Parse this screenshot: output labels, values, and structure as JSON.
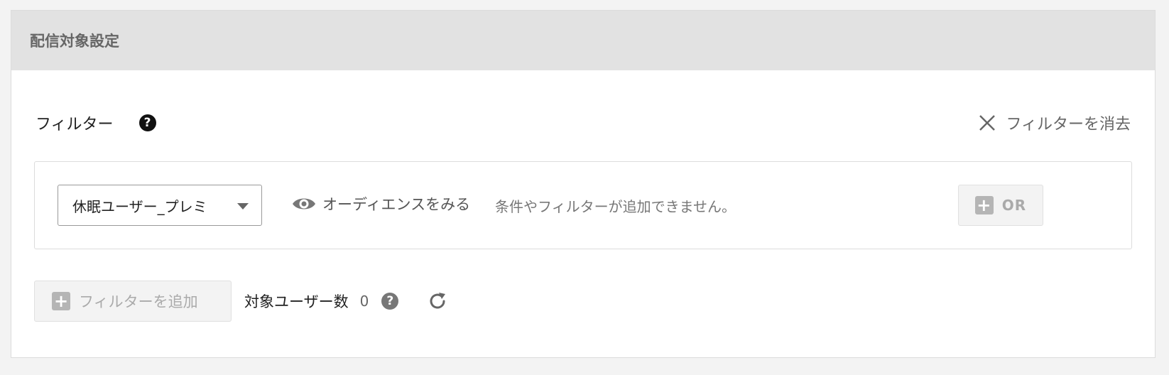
{
  "panel": {
    "title": "配信対象設定"
  },
  "filter": {
    "label": "フィルター",
    "help_glyph": "?",
    "clear_label": "フィルターを消去"
  },
  "condition": {
    "segment_selected": "休眠ユーザー_プレミ",
    "audience_link": "オーディエンスをみる",
    "notice": "条件やフィルターが追加できません。",
    "or_label": "OR",
    "plus_glyph": "+"
  },
  "footer": {
    "add_filter_label": "フィルターを追加",
    "plus_glyph": "+",
    "target_users_label": "対象ユーザー数",
    "target_users_count": "0",
    "help_glyph": "?"
  },
  "icons": {
    "help": "question-circle-icon",
    "close": "close-icon",
    "eye": "eye-icon",
    "plus": "plus-square-icon",
    "refresh": "refresh-icon",
    "caret": "chevron-down-icon"
  },
  "colors": {
    "header_bg": "#e2e2e2",
    "page_bg": "#f3f3f3",
    "disabled_text": "#aaaaaa",
    "muted_text": "#666666"
  }
}
